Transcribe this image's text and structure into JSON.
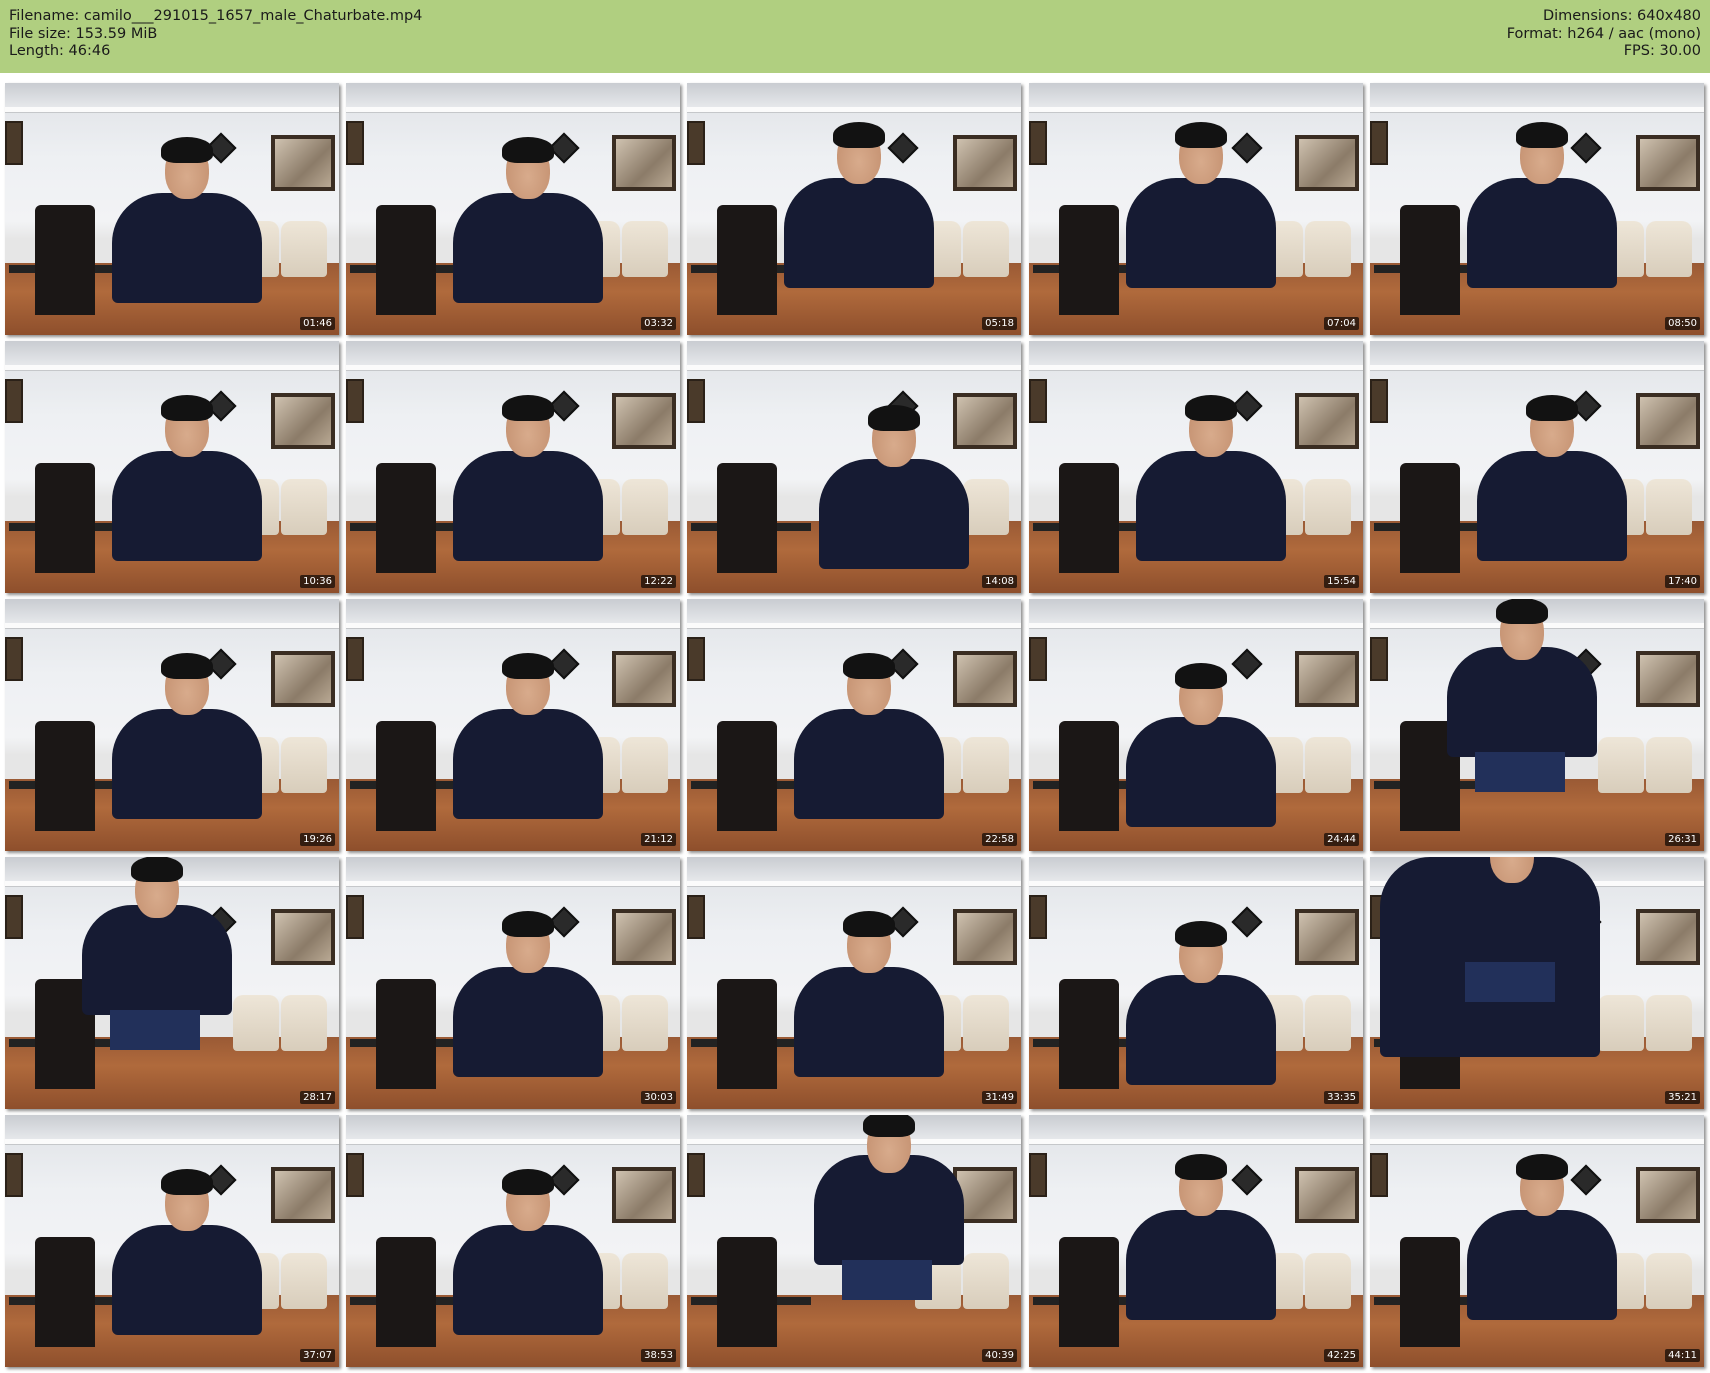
{
  "header": {
    "filename_line": "Filename: camilo___291015_1657_male_Chaturbate.mp4",
    "filesize_line": "File size: 153.59 MiB",
    "length_line": "Length: 46:46",
    "dimensions_line": "Dimensions: 640x480",
    "format_line": "Format: h264 / aac (mono)",
    "fps_line": "FPS: 30.00"
  },
  "colors": {
    "header_bg": "#b0cf80",
    "timestamp_bg": "#000000",
    "shirt": "#161b33"
  },
  "thumbnails": [
    {
      "time": "01:46",
      "pose": "seated"
    },
    {
      "time": "03:32",
      "pose": "seated"
    },
    {
      "time": "05:18",
      "pose": "seated-close"
    },
    {
      "time": "07:04",
      "pose": "seated-close"
    },
    {
      "time": "08:50",
      "pose": "seated-close"
    },
    {
      "time": "10:36",
      "pose": "seated"
    },
    {
      "time": "12:22",
      "pose": "seated"
    },
    {
      "time": "14:08",
      "pose": "leaning"
    },
    {
      "time": "15:54",
      "pose": "seated"
    },
    {
      "time": "17:40",
      "pose": "seated"
    },
    {
      "time": "19:26",
      "pose": "seated"
    },
    {
      "time": "21:12",
      "pose": "seated"
    },
    {
      "time": "22:58",
      "pose": "seated"
    },
    {
      "time": "24:44",
      "pose": "seated-far"
    },
    {
      "time": "26:31",
      "pose": "standing"
    },
    {
      "time": "28:17",
      "pose": "standing"
    },
    {
      "time": "30:03",
      "pose": "seated"
    },
    {
      "time": "31:49",
      "pose": "seated"
    },
    {
      "time": "33:35",
      "pose": "seated-far"
    },
    {
      "time": "35:21",
      "pose": "close-body"
    },
    {
      "time": "37:07",
      "pose": "seated"
    },
    {
      "time": "38:53",
      "pose": "seated"
    },
    {
      "time": "40:39",
      "pose": "crouching"
    },
    {
      "time": "42:25",
      "pose": "seated-close"
    },
    {
      "time": "44:11",
      "pose": "seated-close"
    }
  ]
}
